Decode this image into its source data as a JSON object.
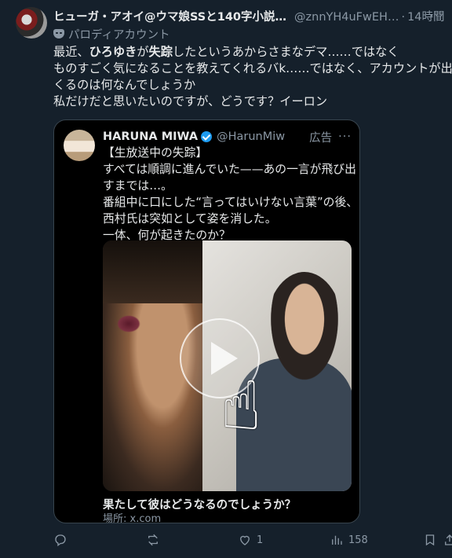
{
  "author": {
    "name": "ヒューガ・アオイ@ウマ娘SSと140字小説…",
    "handle": "@znnYH4uFwEH…",
    "time": "14時間",
    "badge": "パロディアカウント"
  },
  "post": {
    "lines": [
      [
        "最近、",
        "ひろゆき",
        "が",
        "失踪",
        "したというあからさまなデマ……ではなく"
      ],
      [
        "ものすごく気になることを教えてくれるバk……ではなく、アカウントが出て"
      ],
      [
        "くるのは何なんでしょうか"
      ],
      [
        "私だけだと思いたいのですが、どうです？イーロン"
      ]
    ]
  },
  "card": {
    "name": "HARUNA MIWA",
    "handle": "@HarunMiw",
    "ad_label": "広告",
    "text_lines": [
      "【生放送中の失踪】",
      "すべては順調に進んでいた——あの一言が飛び出",
      "すまでは…。",
      "番組中に口にした“言ってはいけない言葉”の後、",
      "西村氏は突如として姿を消した。",
      "一体、何が起きたのか？"
    ],
    "link_title": "果たして彼はどうなるのでしょうか？",
    "link_source": "場所: x.com"
  },
  "actions": {
    "reply_count": "",
    "repost_count": "",
    "like_count": "1",
    "views_count": "158"
  },
  "colors": {
    "background": "#15202b",
    "text": "#e7e9ea",
    "muted": "#8b98a5",
    "verified": "#1d9bf0"
  }
}
